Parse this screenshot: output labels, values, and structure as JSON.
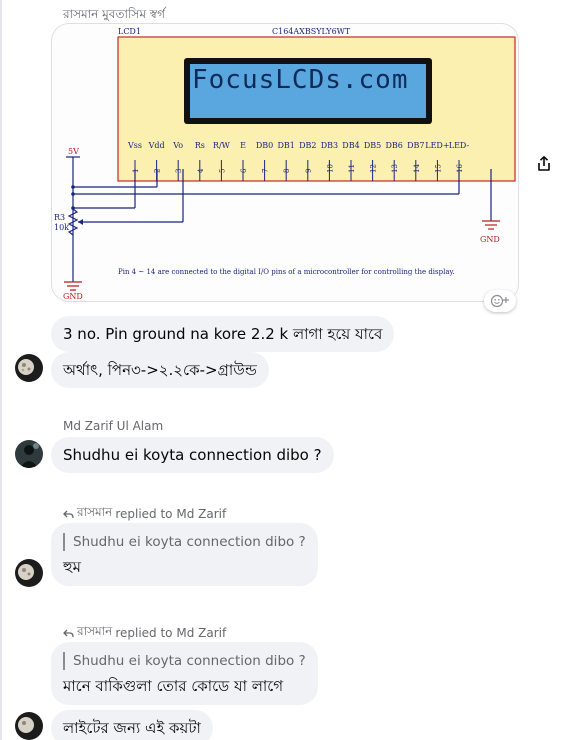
{
  "thread": {
    "first_sender": "রাসমান মুবতাসিম স্বর্গ",
    "schematic": {
      "lcd_name": "LCD1",
      "part_number": "C164AXBSYLY6WT",
      "screen_text": "FocusLCDs.com",
      "pin_labels": [
        "Vss",
        "Vdd",
        "Vo",
        "Rs",
        "R/W",
        "E",
        "DB0",
        "DB1",
        "DB2",
        "DB3",
        "DB4",
        "DB5",
        "DB6",
        "DB7",
        "LED+",
        "LED-"
      ],
      "pin_numbers": [
        "1",
        "2",
        "3",
        "4",
        "5",
        "6",
        "7",
        "8",
        "9",
        "10",
        "11",
        "12",
        "13",
        "14",
        "15",
        "16"
      ],
      "supply_label": "5V",
      "resistor_label": "R3",
      "resistor_value": "10k",
      "gnd_left": "GND",
      "gnd_right": "GND",
      "caption": "Pin 4 ~ 14 are connected to the digital I/O pins of a microcontroller for controlling the display."
    },
    "messages": {
      "m1": "3 no. Pin ground na kore 2.2 k লাগা হয়ে যাবে",
      "m2": "অর্থাৎ, পিন৩->২.২কে->গ্রাউন্ড",
      "m3_sender": "Md Zarif Ul Alam",
      "m3": "Shudhu ei koyta connection dibo ?",
      "m4_reply_name": "রাসমান",
      "m4_reply_text": "replied to Md Zarif",
      "m4_quote": "Shudhu ei koyta connection dibo ?",
      "m4": "হুম",
      "m5_reply_name": "রাসমান",
      "m5_reply_text": "replied to Md Zarif",
      "m5_quote": "Shudhu ei koyta connection dibo ?",
      "m5": "মানে বাকিগুলা তোর কোডে যা লাগে",
      "m6": "লাইটের জন্য এই কয়টা"
    }
  },
  "icons": {
    "share": "share-icon",
    "reaction": "add-reaction-icon",
    "reply": "reply-arrow-icon"
  },
  "colors": {
    "bubble_bg": "#f0f2f5",
    "lcd_body": "#fbf0b0",
    "lcd_border": "#c62828",
    "lcd_screen": "#5aa7e0",
    "secondary_text": "#65676b"
  }
}
